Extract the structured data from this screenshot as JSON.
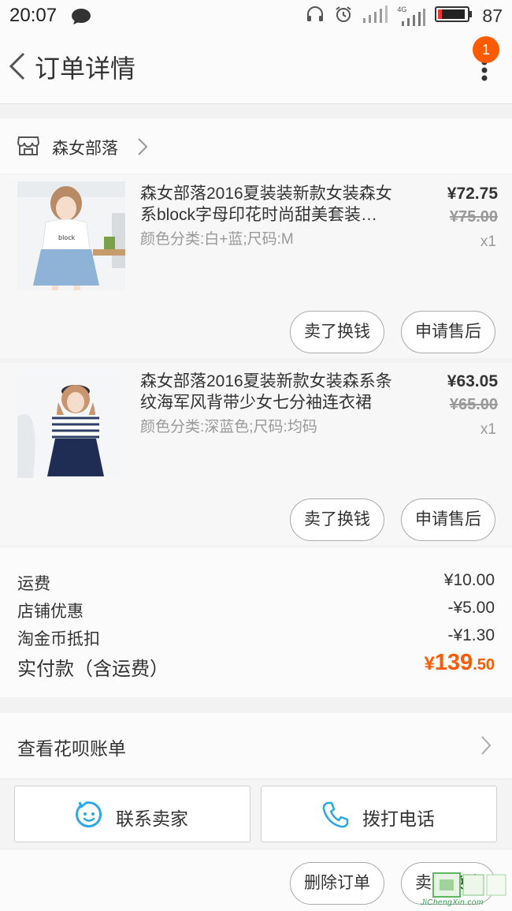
{
  "status_bar": {
    "time": "20:07",
    "network": "4G",
    "battery": "87"
  },
  "header": {
    "title": "订单详情",
    "badge_count": "1"
  },
  "shop": {
    "name": "森女部落"
  },
  "items": [
    {
      "title": "森女部落2016夏装装新款女装森女系block字母印花时尚甜美套装…",
      "sku": "颜色分类:白+蓝;尺码:M",
      "price": "¥72.75",
      "original_price": "¥75.00",
      "quantity": "x1",
      "actions": [
        "卖了换钱",
        "申请售后"
      ]
    },
    {
      "title": "森女部落2016夏装新款女装森系条纹海军风背带少女七分袖连衣裙",
      "sku": "颜色分类:深蓝色;尺码:均码",
      "price": "¥63.05",
      "original_price": "¥65.00",
      "quantity": "x1",
      "actions": [
        "卖了换钱",
        "申请售后"
      ]
    }
  ],
  "summary": {
    "rows": [
      {
        "label": "运费",
        "value": "¥10.00"
      },
      {
        "label": "店铺优惠",
        "value": "-¥5.00"
      },
      {
        "label": "淘金币抵扣",
        "value": "-¥1.30"
      }
    ],
    "total_label": "实付款（含运费）",
    "total_currency": "¥",
    "total_integer": "139",
    "total_decimal": ".50"
  },
  "huabei": {
    "label": "查看花呗账单"
  },
  "contact": {
    "seller_label": "联系卖家",
    "phone_label": "拨打电话"
  },
  "bottom_actions": [
    "删除订单",
    "卖了换钱"
  ],
  "watermark": {
    "text": "JiChengXin.com"
  },
  "colors": {
    "accent": "#ff5a00",
    "contact_icon": "#2aa7e6"
  }
}
